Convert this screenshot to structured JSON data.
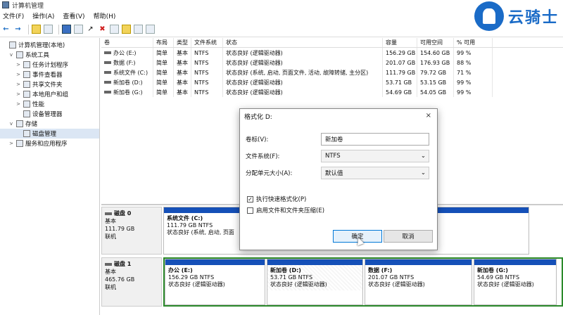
{
  "window": {
    "title": "计算机管理"
  },
  "menu": [
    "文件(F)",
    "操作(A)",
    "查看(V)",
    "帮助(H)"
  ],
  "logo": {
    "text": "云骑士",
    "color": "#1a6bc7"
  },
  "tree": [
    {
      "label": "计算机管理(本地)",
      "level": 0,
      "caret": ""
    },
    {
      "label": "系统工具",
      "level": 1,
      "caret": "v"
    },
    {
      "label": "任务计划程序",
      "level": 2,
      "caret": ">"
    },
    {
      "label": "事件查看器",
      "level": 2,
      "caret": ">"
    },
    {
      "label": "共享文件夹",
      "level": 2,
      "caret": ">"
    },
    {
      "label": "本地用户和组",
      "level": 2,
      "caret": ">"
    },
    {
      "label": "性能",
      "level": 2,
      "caret": ">"
    },
    {
      "label": "设备管理器",
      "level": 2,
      "caret": ""
    },
    {
      "label": "存储",
      "level": 1,
      "caret": "v"
    },
    {
      "label": "磁盘管理",
      "level": 2,
      "caret": "",
      "selected": true
    },
    {
      "label": "服务和应用程序",
      "level": 1,
      "caret": ">"
    }
  ],
  "volumes": {
    "headers": [
      "卷",
      "布局",
      "类型",
      "文件系统",
      "状态",
      "容量",
      "可用空间",
      "% 可用"
    ],
    "rows": [
      [
        "办公 (E:)",
        "简单",
        "基本",
        "NTFS",
        "状态良好 (逻辑驱动器)",
        "156.29 GB",
        "154.60 GB",
        "99 %"
      ],
      [
        "数据 (F:)",
        "简单",
        "基本",
        "NTFS",
        "状态良好 (逻辑驱动器)",
        "201.07 GB",
        "176.93 GB",
        "88 %"
      ],
      [
        "系统文件 (C:)",
        "简单",
        "基本",
        "NTFS",
        "状态良好 (系统, 启动, 页面文件, 活动, 故障转储, 主分区)",
        "111.79 GB",
        "79.72 GB",
        "71 %"
      ],
      [
        "新加卷 (D:)",
        "简单",
        "基本",
        "NTFS",
        "状态良好 (逻辑驱动器)",
        "53.71 GB",
        "53.15 GB",
        "99 %"
      ],
      [
        "新加卷 (G:)",
        "简单",
        "基本",
        "NTFS",
        "状态良好 (逻辑驱动器)",
        "54.69 GB",
        "54.05 GB",
        "99 %"
      ]
    ]
  },
  "disk0": {
    "name": "磁盘 0",
    "type": "基本",
    "size": "111.79 GB",
    "status": "联机",
    "partition": {
      "name": "系统文件  (C:)",
      "size": "111.79 GB NTFS",
      "status": "状态良好 (系统, 启动, 页面"
    }
  },
  "disk1": {
    "name": "磁盘 1",
    "type": "基本",
    "size": "465.76 GB",
    "status": "联机",
    "partitions": [
      {
        "name": "办公  (E:)",
        "size": "156.29 GB NTFS",
        "status": "状态良好 (逻辑驱动器)"
      },
      {
        "name": "新加卷  (D:)",
        "size": "53.71 GB NTFS",
        "status": "状态良好 (逻辑驱动器)"
      },
      {
        "name": "数据  (F:)",
        "size": "201.07 GB NTFS",
        "status": "状态良好 (逻辑驱动器)"
      },
      {
        "name": "新加卷  (G:)",
        "size": "54.69 GB NTFS",
        "status": "状态良好 (逻辑驱动器)"
      }
    ]
  },
  "dialog": {
    "title": "格式化 D:",
    "close": "×",
    "volume_label": "卷标(V):",
    "volume_value": "新加卷",
    "fs_label": "文件系统(F):",
    "fs_value": "NTFS",
    "alloc_label": "分配单元大小(A):",
    "alloc_value": "默认值",
    "quick_format": "执行快速格式化(P)",
    "quick_checked": "✓",
    "compress": "启用文件和文件夹压缩(E)",
    "ok": "确定",
    "cancel": "取消"
  },
  "colors": {
    "partition_bar": "#1550b8",
    "accent": "#0078d7"
  }
}
